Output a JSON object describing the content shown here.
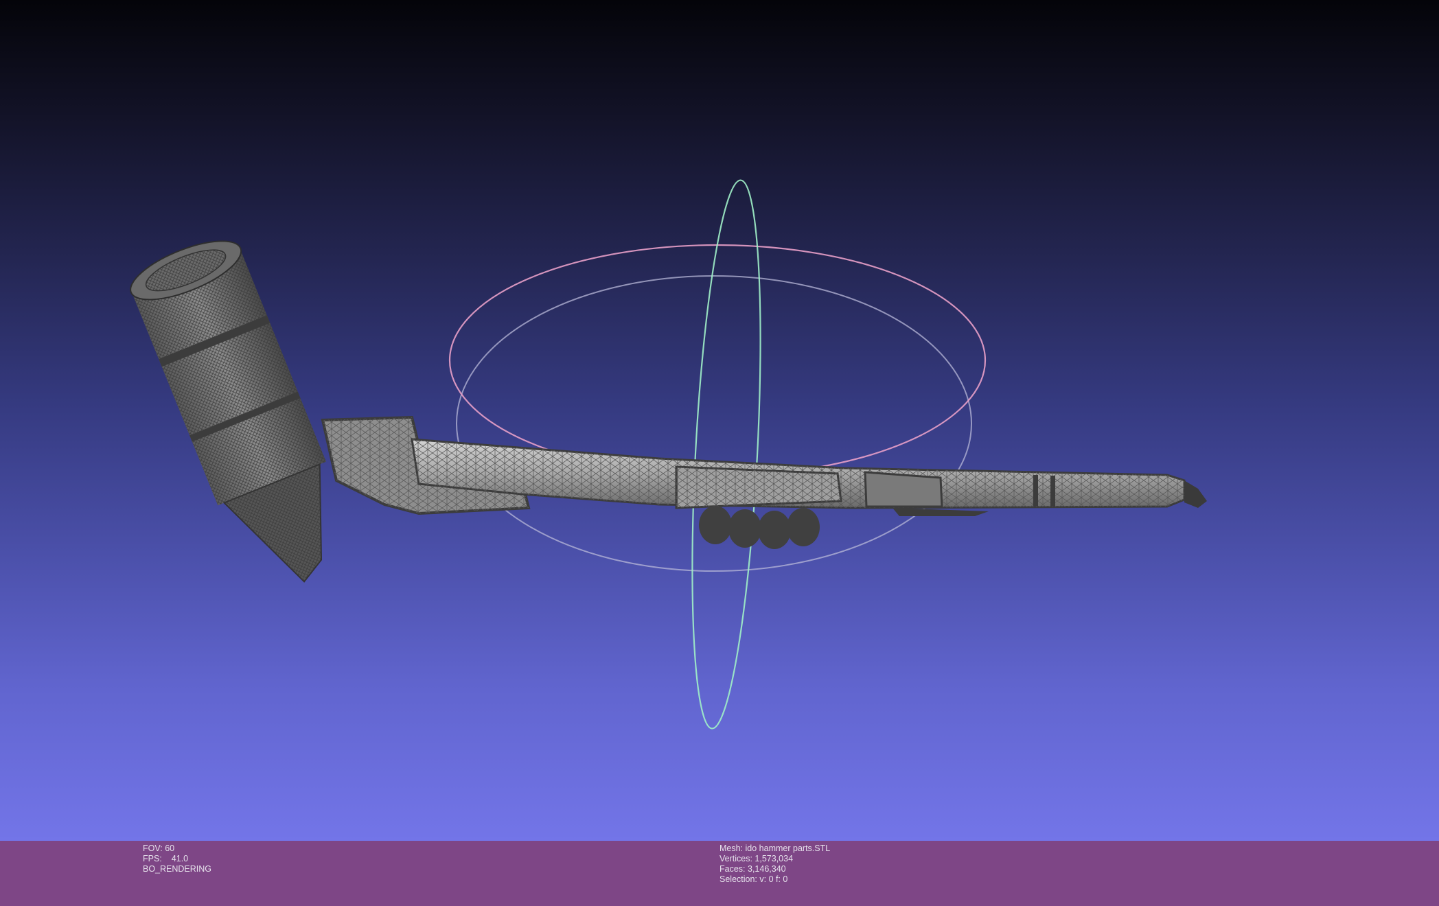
{
  "render_stats": {
    "fov_label": "FOV:",
    "fov_value": "60",
    "fps_label": "FPS:",
    "fps_value": "41.0",
    "render_mode": "BO_RENDERING"
  },
  "mesh_info": {
    "mesh_label": "Mesh:",
    "mesh_name": "ido hammer parts.STL",
    "vertices_label": "Vertices:",
    "vertices_value": "1,573,034",
    "faces_label": "Faces:",
    "faces_value": "3,146,340",
    "selection_label": "Selection:",
    "selection_value": "v: 0 f: 0"
  },
  "colors": {
    "info_bar_bg": "#7e4686",
    "viewport_top": "#040409",
    "viewport_bottom": "#7375e8",
    "mesh_fill": "#9c9c9c",
    "mesh_dark": "#3c3c3c",
    "gizmo_x_ring": "#e8a0c8",
    "gizmo_y_ring": "#9cf0c8",
    "gizmo_z_ring": "#b0b0d8"
  },
  "icons": [
    "trackball-gizmo-icon",
    "mesh-model-icon"
  ]
}
